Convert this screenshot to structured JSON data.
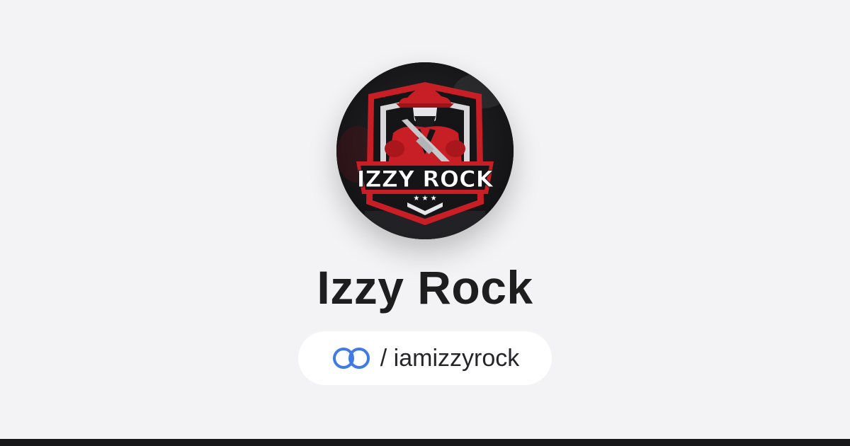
{
  "profile": {
    "display_name": "Izzy Rock",
    "handle_separator": "/",
    "handle": "iamizzyrock",
    "handle_text": "/ iamizzyrock"
  },
  "logo": {
    "text": "IZZY ROCK",
    "stars": "★ ★ ★"
  },
  "icons": {
    "pill_icon": "linked-rings-icon"
  },
  "colors": {
    "background": "#f3f3f5",
    "accent_blue": "#3f7ae6",
    "logo_red": "#d01f26",
    "text_dark": "#1e1e1f",
    "bottom_bar": "#17171a"
  }
}
